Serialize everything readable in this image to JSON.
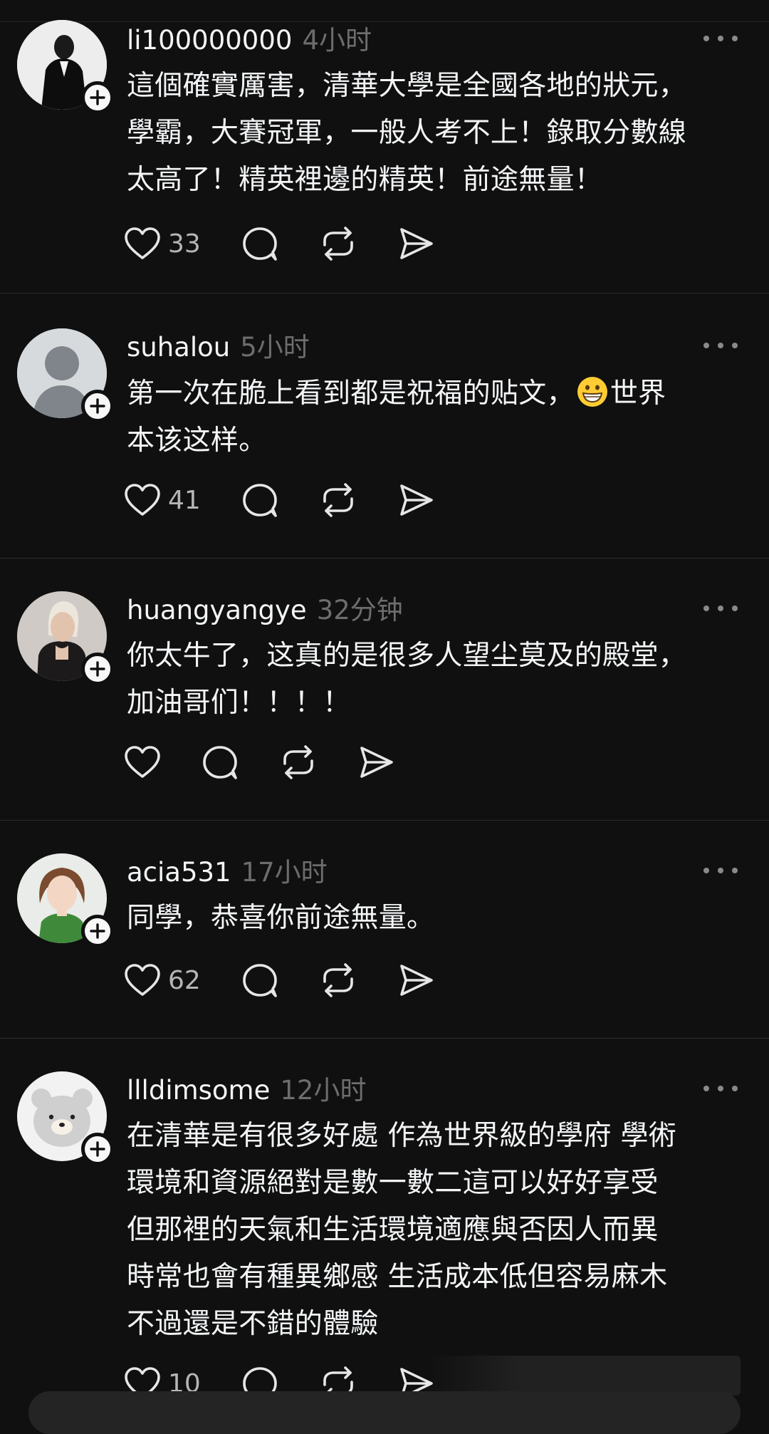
{
  "posts": [
    {
      "username": "li100000000",
      "time": "4小时",
      "text": "這個確實厲害，清華大學是全國各地的狀元，\n學霸，大賽冠軍，一般人考不上！錄取分數線\n太高了！精英裡邊的精英！前途無量！",
      "likes": "33",
      "avatar": "man-in-suit-photo"
    },
    {
      "username": "suhalou",
      "time": "5小时",
      "text_before_emoji": "第一次在脆上看到都是祝福的贴文，",
      "emoji": "grinning-face-emoji",
      "text_after_emoji": "世界\n本该这样。",
      "likes": "41",
      "avatar": "default-person-avatar"
    },
    {
      "username": "huangyangye",
      "time": "32分钟",
      "text": "你太牛了，这真的是很多人望尘莫及的殿堂，\n加油哥们！！！！",
      "likes": "",
      "avatar": "blonde-woman-photo"
    },
    {
      "username": "acia531",
      "time": "17小时",
      "text": "同學，恭喜你前途無量。",
      "likes": "62",
      "avatar": "young-woman-photo"
    },
    {
      "username": "llldimsome",
      "time": "12小时",
      "text": "在清華是有很多好處 作為世界級的學府 學術\n環境和資源絕對是數一數二這可以好好享受\n但那裡的天氣和生活環境適應與否因人而異\n時常也會有種異鄉感 生活成本低但容易麻木\n不過還是不錯的體驗",
      "likes": "10",
      "avatar": "bear-avatar"
    }
  ],
  "icons": {
    "like": "heart-icon",
    "reply": "comment-bubble-icon",
    "repost": "repost-arrows-icon",
    "share": "send-arrow-icon",
    "more": "more-dots-icon",
    "follow": "plus-icon"
  },
  "colors": {
    "background": "#101010",
    "text": "#f3f5f7",
    "secondary": "#6d6d6d",
    "divider": "#2c2c2c"
  }
}
